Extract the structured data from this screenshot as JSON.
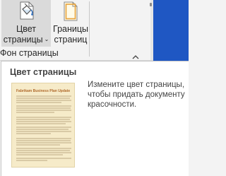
{
  "ribbon": {
    "page_color_button": {
      "label_line1": "Цвет",
      "label_line2": "страницы",
      "caret": "⌄",
      "icon": "paint-bucket-page-icon"
    },
    "page_borders_button": {
      "label_line1": "Границы",
      "label_line2": "страниц",
      "icon": "page-borders-icon"
    },
    "group_label": "Фон страницы",
    "collapse_icon": "chevron-up-icon"
  },
  "tooltip": {
    "title": "Цвет страницы",
    "preview_heading": "Fabrikam Business Plan Update",
    "description_lines": [
      "Измените цвет страницы,",
      "чтобы придать документу",
      "красочности."
    ]
  },
  "colors": {
    "ribbon_bg": "#f3f3f3",
    "button_pressed_bg": "#dadada",
    "tooltip_bg": "#ffffff",
    "preview_page": "#f6ebc9",
    "window_blue": "#1f57c3",
    "accent_orange": "#e8a33a"
  }
}
